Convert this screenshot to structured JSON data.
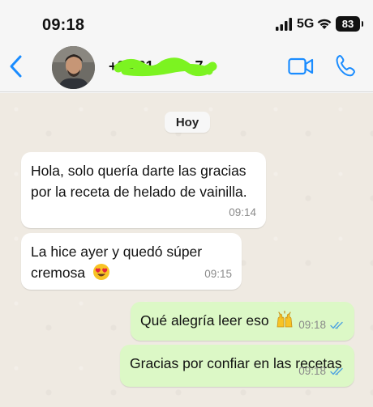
{
  "status_bar": {
    "time": "09:18",
    "network": "5G",
    "battery": "83"
  },
  "header": {
    "contact_name": "+34 61· ·· ·· ·7",
    "back_icon": "chevron-left-icon",
    "video_icon": "video-camera-icon",
    "call_icon": "phone-icon"
  },
  "chat": {
    "date_label": "Hoy",
    "messages": [
      {
        "direction": "incoming",
        "lines": [
          "Hola, solo quería darte las gracias",
          "por la receta de helado de vainilla."
        ],
        "time": "09:14"
      },
      {
        "direction": "incoming",
        "lines": [
          "La hice ayer y quedó súper",
          "cremosa"
        ],
        "emoji": "heart-eyes",
        "time": "09:15"
      },
      {
        "direction": "outgoing",
        "lines": [
          "Qué alegría leer eso"
        ],
        "emoji": "raising-hands",
        "time": "09:18",
        "status": "read"
      },
      {
        "direction": "outgoing",
        "lines": [
          "Gracias por confiar en las recetas"
        ],
        "time": "09:18",
        "status": "read"
      }
    ]
  },
  "colors": {
    "accent": "#1a8cff",
    "chat_background": "#efeae2",
    "incoming_bubble": "#ffffff",
    "outgoing_bubble": "#dcf8c6",
    "redaction": "#7cf321",
    "read_ticks": "#4fa3e0"
  }
}
